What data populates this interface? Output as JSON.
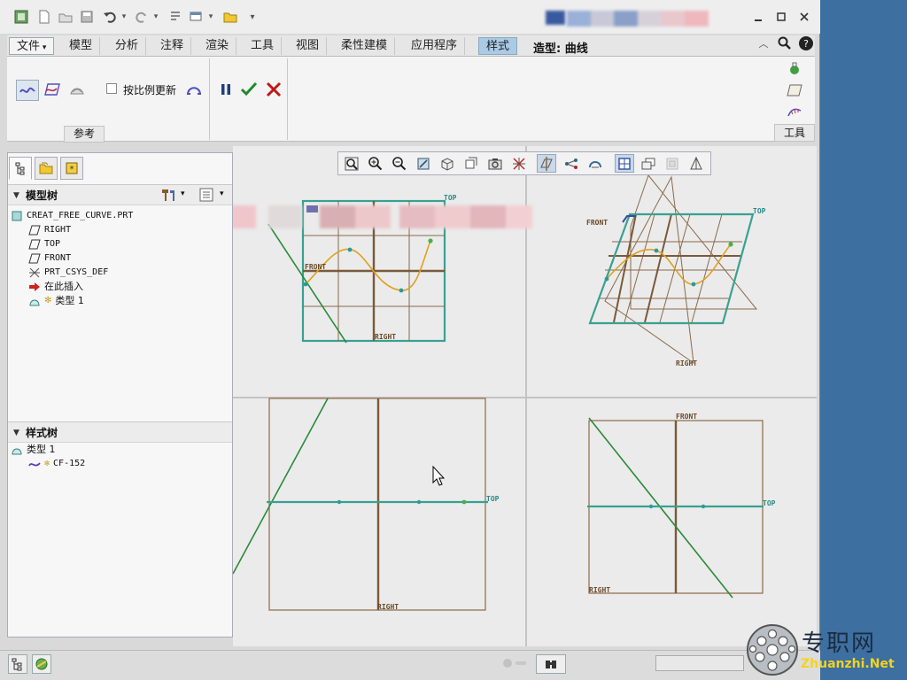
{
  "titlebar": {
    "title": "",
    "window_controls": [
      "minimize-icon",
      "maximize-icon",
      "close-icon"
    ]
  },
  "menu": {
    "file": "文件",
    "tabs": [
      "模型",
      "分析",
      "注释",
      "渲染",
      "工具",
      "视图",
      "柔性建模",
      "应用程序"
    ],
    "active_tab": "样式",
    "context_title": "造型: 曲线"
  },
  "ribbon": {
    "checkbox_label": "按比例更新",
    "group_label": "参考",
    "tools_label": "工具"
  },
  "model_tree": {
    "header": "模型树",
    "items": [
      {
        "label": "CREAT_FREE_CURVE.PRT",
        "icon": "part-icon"
      },
      {
        "label": "RIGHT",
        "icon": "datum-plane-icon"
      },
      {
        "label": "TOP",
        "icon": "datum-plane-icon"
      },
      {
        "label": "FRONT",
        "icon": "datum-plane-icon"
      },
      {
        "label": "PRT_CSYS_DEF",
        "icon": "csys-icon"
      },
      {
        "label": "在此插入",
        "icon": "insert-here-arrow-icon"
      },
      {
        "label": "类型 1",
        "icon": "style-feature-icon"
      }
    ]
  },
  "style_tree": {
    "header": "样式树",
    "items": [
      {
        "label": "类型 1",
        "icon": "style-feature-icon"
      },
      {
        "label": "CF-152",
        "icon": "curve-icon"
      }
    ]
  },
  "viewports": {
    "labels": {
      "top": "TOP",
      "front": "FRONT",
      "right": "RIGHT"
    }
  },
  "watermark": {
    "title": "专职网",
    "url": "Zhuanzhi.Net"
  },
  "colors": {
    "accent": "#aacae6",
    "datum_plane": "#8a6a48",
    "datum_plane_edge": "#3aa090",
    "curve": "#e0a020",
    "green_line": "#2a8a3a"
  }
}
